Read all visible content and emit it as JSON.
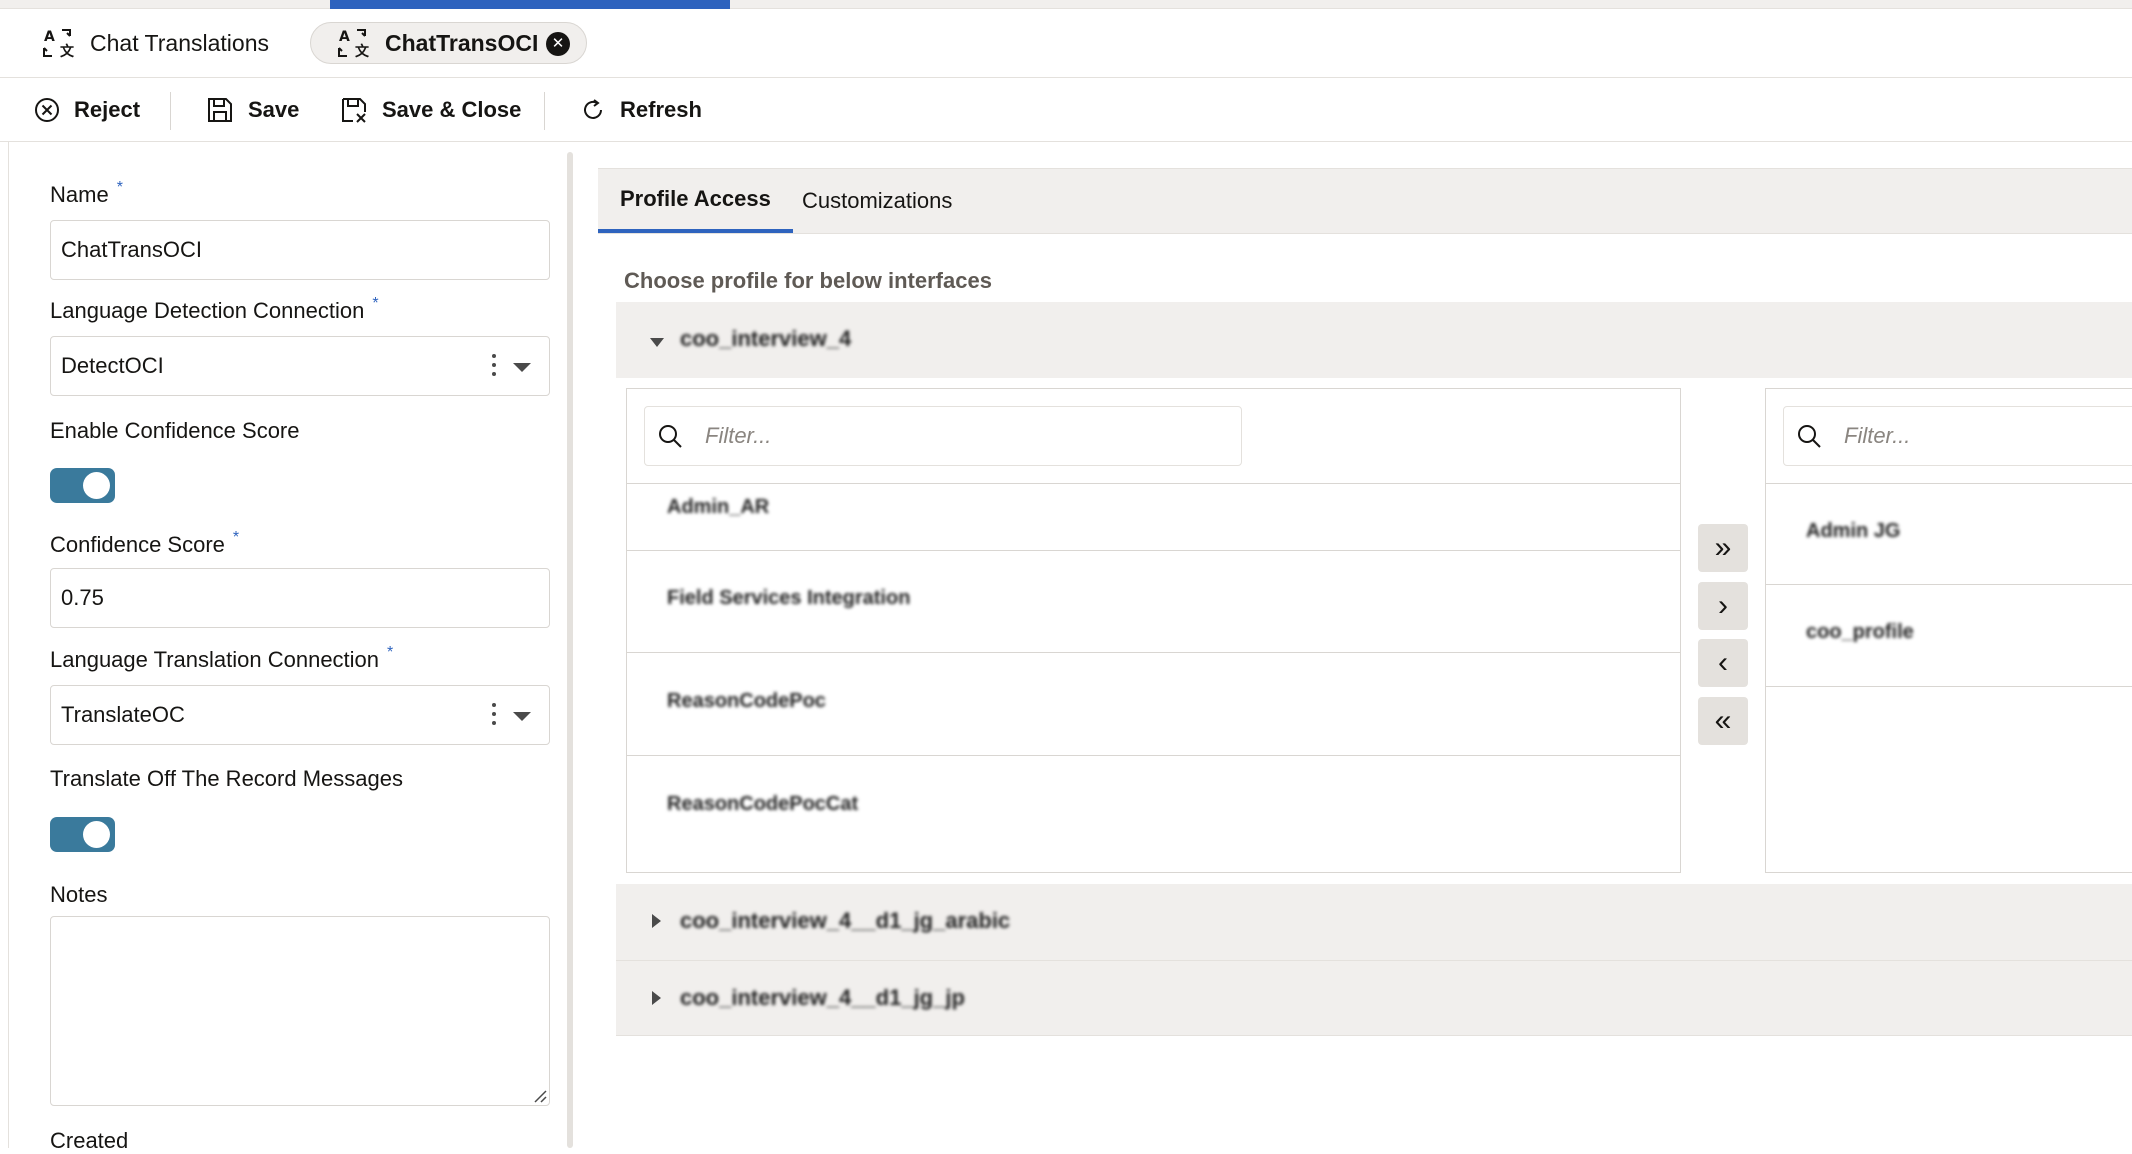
{
  "tabs": [
    {
      "label": "Chat Translations",
      "icon": "translate-icon",
      "active": false
    },
    {
      "label": "ChatTransOCI",
      "icon": "translate-icon",
      "active": true,
      "closable": true
    }
  ],
  "toolbar": {
    "reject": "Reject",
    "save": "Save",
    "save_close": "Save & Close",
    "refresh": "Refresh"
  },
  "form": {
    "name_label": "Name",
    "name_value": "ChatTransOCI",
    "detect_label": "Language Detection Connection",
    "detect_value": "DetectOCI",
    "confidence_toggle_label": "Enable Confidence Score",
    "confidence_toggle_on": true,
    "confidence_label": "Confidence Score",
    "confidence_value": "0.75",
    "translate_label": "Language Translation Connection",
    "translate_value": "TranslateOC",
    "otr_label": "Translate Off The Record Messages",
    "otr_toggle_on": true,
    "notes_label": "Notes",
    "created_label": "Created",
    "required_mark": "*"
  },
  "content": {
    "tabs": [
      "Profile Access",
      "Customizations"
    ],
    "active_tab": "Profile Access",
    "chooser_title": "Choose profile for below interfaces",
    "interfaces": [
      {
        "label": "coo_interview_4",
        "expanded": true
      },
      {
        "label": "coo_interview_4__d1_jg_arabic",
        "expanded": false
      },
      {
        "label": "coo_interview_4__d1_jg_jp",
        "expanded": false
      }
    ],
    "filter_placeholder": "Filter...",
    "available": [
      "Admin_AR",
      "Field Services Integration",
      "ReasonCodePoc",
      "ReasonCodePocCat"
    ],
    "selected": [
      "Admin JG",
      "coo_profile"
    ],
    "shuttle": {
      "all_right": "»",
      "right": "›",
      "left": "‹",
      "all_left": "«"
    }
  }
}
